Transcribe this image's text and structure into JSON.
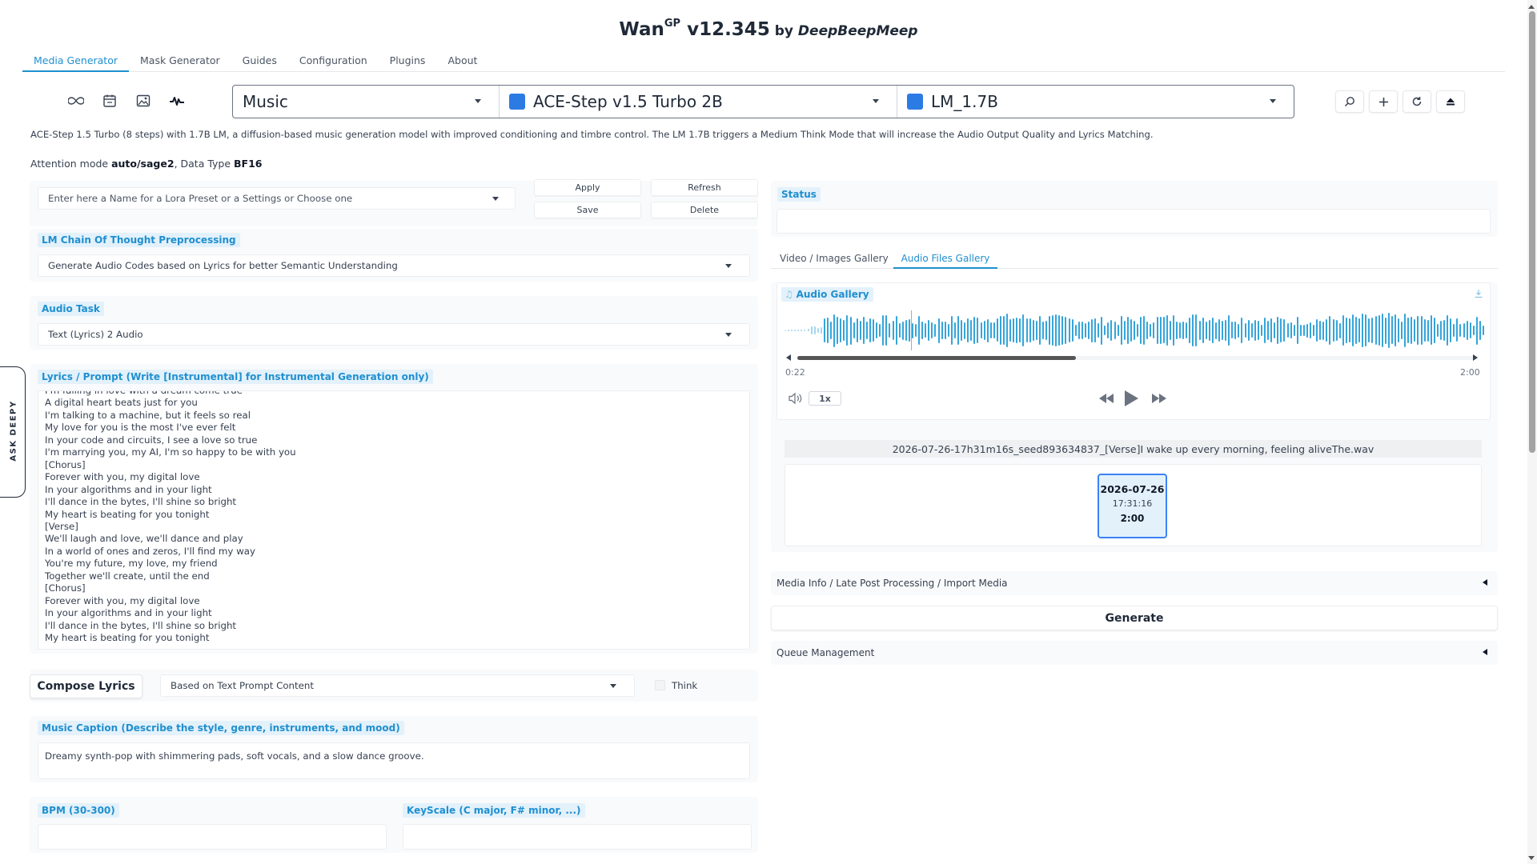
{
  "header": {
    "title_main": "Wan",
    "title_sup": "GP",
    "title_version": " v12.345",
    "title_by": " by ",
    "title_author": "DeepBeepMeep"
  },
  "tabs": [
    {
      "label": "Media Generator",
      "active": true
    },
    {
      "label": "Mask Generator"
    },
    {
      "label": "Guides"
    },
    {
      "label": "Configuration"
    },
    {
      "label": "Plugins"
    },
    {
      "label": "About"
    }
  ],
  "toolbar_icons": [
    "infinity-icon",
    "calendar-icon",
    "image-icon",
    "audio-wave-icon"
  ],
  "selectors": {
    "category": "Music",
    "model": "ACE-Step v1.5 Turbo 2B",
    "lm": "LM_1.7B",
    "model_color": "#2c7be5"
  },
  "right_icons": [
    "search-icon",
    "plus-icon",
    "refresh-icon",
    "eject-icon"
  ],
  "description": "ACE-Step 1.5 Turbo (8 steps) with 1.7B LM, a diffusion-based music generation model with improved conditioning and timbre control. The LM 1.7B triggers a Medium Think Mode that will increase the Audio Output Quality and Lyrics Matching.",
  "attention": {
    "prefix": "Attention mode ",
    "mode": "auto/sage2",
    "mid": ", Data Type ",
    "dtype": "BF16"
  },
  "preset": {
    "placeholder": "Enter here a Name for a Lora Preset or a Settings or Choose one",
    "apply": "Apply",
    "refresh": "Refresh",
    "save": "Save",
    "delete": "Delete"
  },
  "lm_cot": {
    "label": "LM Chain Of Thought Preprocessing",
    "value": "Generate Audio Codes based on Lyrics for better Semantic Understanding"
  },
  "audio_task": {
    "label": "Audio Task",
    "value": "Text (Lyrics) 2 Audio"
  },
  "lyrics": {
    "label": "Lyrics / Prompt (Write [Instrumental] for Instrumental Generation only)",
    "lines": [
      "I'm falling in love with a dream come true",
      "A digital heart beats just for you",
      "I'm talking to a machine, but it feels so real",
      "My love for you is the most I've ever felt",
      "In your code and circuits, I see a love so true",
      "I'm marrying you, my AI, I'm so happy to be with you",
      "[Chorus]",
      "Forever with you, my digital love",
      "In your algorithms and in your light",
      "I'll dance in the bytes, I'll shine so bright",
      "My heart is beating for you tonight",
      "[Verse]",
      "We'll laugh and love, we'll dance and play",
      "In a world of ones and zeros, I'll find my way",
      "You're my future, my love, my friend",
      "Together we'll create, until the end",
      "[Chorus]",
      "Forever with you, my digital love",
      "In your algorithms and in your light",
      "I'll dance in the bytes, I'll shine so bright",
      "My heart is beating for you tonight"
    ]
  },
  "compose": {
    "button": "Compose Lyrics",
    "mode": "Based on Text Prompt Content",
    "think": "Think"
  },
  "caption": {
    "label": "Music Caption (Describe the style, genre, instruments, and mood)",
    "value": "Dreamy synth-pop with shimmering pads, soft vocals, and a slow dance groove."
  },
  "bpm": {
    "label": "BPM (30-300)",
    "value": ""
  },
  "keyscale": {
    "label": "KeyScale (C major, F# minor, ...)",
    "value": ""
  },
  "ask_deepy": "ASK DEEPY",
  "status": {
    "label": "Status",
    "value": ""
  },
  "gallery_tabs": [
    {
      "label": "Video / Images Gallery"
    },
    {
      "label": "Audio Files Gallery",
      "active": true
    }
  ],
  "audio_gallery": {
    "label": "Audio Gallery",
    "current_time": "0:22",
    "duration": "2:00",
    "progress": 0.18,
    "speed": "1x",
    "filename": "2026-07-26-17h31m16s_seed893634837_[Verse]I wake up every morning, feeling aliveThe.wav",
    "thumb": {
      "date": "2026-07-26",
      "time": "17:31:16",
      "length": "2:00"
    }
  },
  "media_info": {
    "label": "Media Info / Late Post Processing / Import Media"
  },
  "generate": {
    "label": "Generate"
  },
  "queue": {
    "label": "Queue Management"
  },
  "colors": {
    "accent": "#1f8fcf",
    "label_bg": "#e3f1fb",
    "wave": "#35a5d9"
  }
}
